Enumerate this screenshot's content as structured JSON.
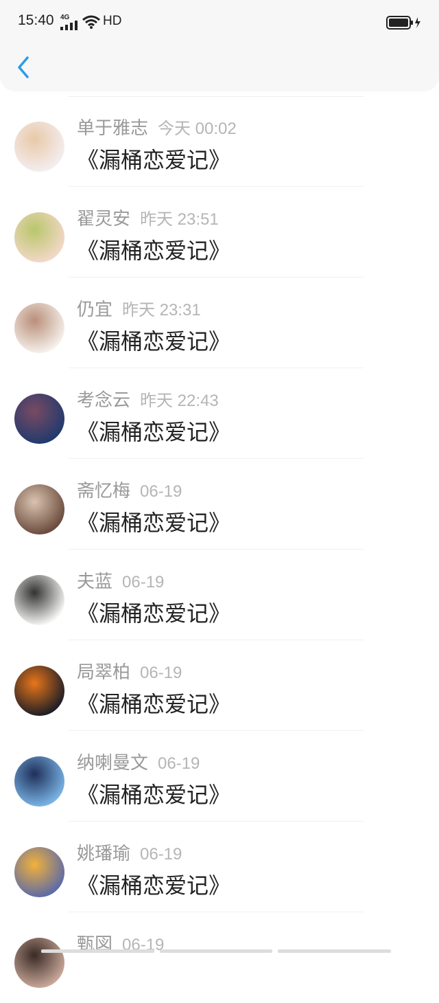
{
  "status_bar": {
    "time": "15:40",
    "network": "4G",
    "hd": "HD"
  },
  "comments": [
    {
      "name": "单于雅志",
      "time": "今天 00:02",
      "message": "《漏桶恋爱记》",
      "avatar_colors": [
        "#f4eef0",
        "#e8c9a8"
      ]
    },
    {
      "name": "翟灵安",
      "time": "昨天 23:51",
      "message": "《漏桶恋爱记》",
      "avatar_colors": [
        "#f3d8c8",
        "#b9c66b"
      ]
    },
    {
      "name": "仍宜",
      "time": "昨天 23:31",
      "message": "《漏桶恋爱记》",
      "avatar_colors": [
        "#f6f1ec",
        "#b98f79"
      ]
    },
    {
      "name": "考念云",
      "time": "昨天 22:43",
      "message": "《漏桶恋爱记》",
      "avatar_colors": [
        "#203a6e",
        "#7a4a62"
      ]
    },
    {
      "name": "斋忆梅",
      "time": "06-19",
      "message": "《漏桶恋爱记》",
      "avatar_colors": [
        "#6a4a3c",
        "#d9c4b0"
      ]
    },
    {
      "name": "夫蓝",
      "time": "06-19",
      "message": "《漏桶恋爱记》",
      "avatar_colors": [
        "#f7f7f5",
        "#333333"
      ]
    },
    {
      "name": "局翠柏",
      "time": "06-19",
      "message": "《漏桶恋爱记》",
      "avatar_colors": [
        "#1d1d26",
        "#e8761a"
      ]
    },
    {
      "name": "纳喇曼文",
      "time": "06-19",
      "message": "《漏桶恋爱记》",
      "avatar_colors": [
        "#7ab5e6",
        "#1f2f5a"
      ]
    },
    {
      "name": "姚璠瑜",
      "time": "06-19",
      "message": "《漏桶恋爱记》",
      "avatar_colors": [
        "#5c6aa8",
        "#f2b13a"
      ]
    },
    {
      "name": "甄図",
      "time": "06-19",
      "message": "",
      "avatar_colors": [
        "#c9a89a",
        "#3a2a24"
      ]
    }
  ],
  "colors": {
    "accent": "#2b9be9",
    "name": "#999999",
    "time": "#b5b5b5",
    "message": "#222222"
  }
}
